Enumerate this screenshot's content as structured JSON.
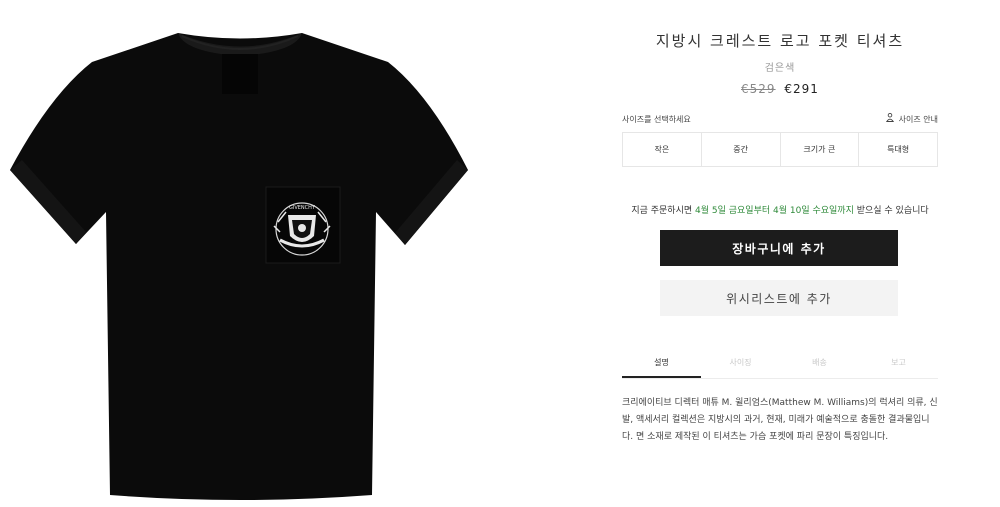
{
  "product": {
    "title": "지방시 크레스트 로고 포켓 티셔츠",
    "color": "검은색",
    "old_price": "€529",
    "new_price": "€291",
    "image_name": "black-pocket-tshirt-image"
  },
  "size": {
    "prompt": "사이즈를 선택하세요",
    "guide_label": "사이즈 안내",
    "guide_icon": "person-icon",
    "options": [
      "작은",
      "중간",
      "크기가 큰",
      "특대형"
    ]
  },
  "delivery": {
    "prefix": "지금 주문하시면 ",
    "highlight": "4월 5일 금요일부터 4월 10일 수요일까지",
    "suffix": " 받으실 수 있습니다"
  },
  "buttons": {
    "add_to_cart": "장바구니에 추가",
    "add_to_wishlist": "위시리스트에 추가"
  },
  "tabs": {
    "items": [
      "설명",
      "사이징",
      "배송",
      "보고"
    ],
    "active": "설명"
  },
  "description": "크리에이티브 디렉터 매튜 M. 윌리엄스(Matthew M. Williams)의 럭셔리 의류, 신발, 액세서리 컬렉션은 지방시의 과거, 현재, 미래가 예술적으로 충돌한 결과물입니다. 면 소재로 제작된 이 티셔츠는 가슴 포켓에 파리 문장이 특징입니다.",
  "colors": {
    "accent_green": "#2f8a3a",
    "cart_button_bg": "#1c1c1c",
    "wishlist_button_bg": "#f3f3f3",
    "shirt": "#0b0b0b"
  }
}
